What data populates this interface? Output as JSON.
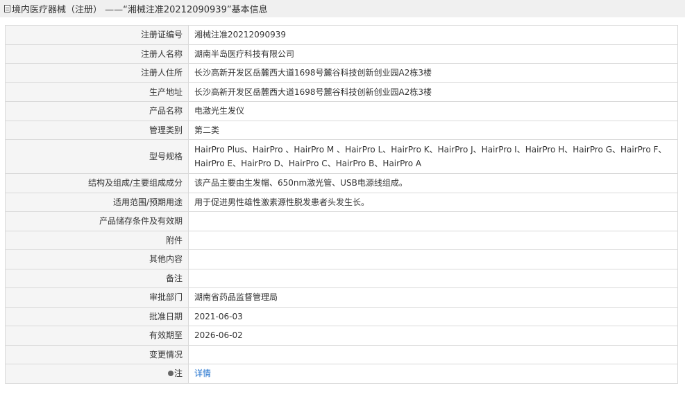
{
  "header": {
    "title": "境内医疗器械（注册）  ——“湘械注准20212090939”基本信息"
  },
  "rows": [
    {
      "label": "注册证编号",
      "value": "湘械注准20212090939"
    },
    {
      "label": "注册人名称",
      "value": "湖南半岛医疗科技有限公司"
    },
    {
      "label": "注册人住所",
      "value": "长沙高新开发区岳麓西大道1698号麓谷科技创新创业园A2栋3楼"
    },
    {
      "label": "生产地址",
      "value": "长沙高新开发区岳麓西大道1698号麓谷科技创新创业园A2栋3楼"
    },
    {
      "label": "产品名称",
      "value": "电激光生发仪"
    },
    {
      "label": "管理类别",
      "value": "第二类"
    },
    {
      "label": "型号规格",
      "value": "HairPro Plus、HairPro 、HairPro M 、HairPro L、HairPro K、HairPro J、HairPro I、HairPro H、HairPro G、HairPro F、HairPro E、HairPro D、HairPro C、HairPro B、HairPro A"
    },
    {
      "label": "结构及组成/主要组成成分",
      "value": "该产品主要由生发帽、650nm激光管、USB电源线组成。"
    },
    {
      "label": "适用范围/预期用途",
      "value": "用于促进男性雄性激素源性脱发患者头发生长。"
    },
    {
      "label": "产品储存条件及有效期",
      "value": ""
    },
    {
      "label": "附件",
      "value": ""
    },
    {
      "label": "其他内容",
      "value": ""
    },
    {
      "label": "备注",
      "value": ""
    },
    {
      "label": "审批部门",
      "value": "湖南省药品监督管理局"
    },
    {
      "label": "批准日期",
      "value": "2021-06-03"
    },
    {
      "label": "有效期至",
      "value": "2026-06-02"
    },
    {
      "label": "变更情况",
      "value": ""
    }
  ],
  "note_row": {
    "label": "注",
    "icon": "lightbulb-icon",
    "link_text": "详情"
  }
}
